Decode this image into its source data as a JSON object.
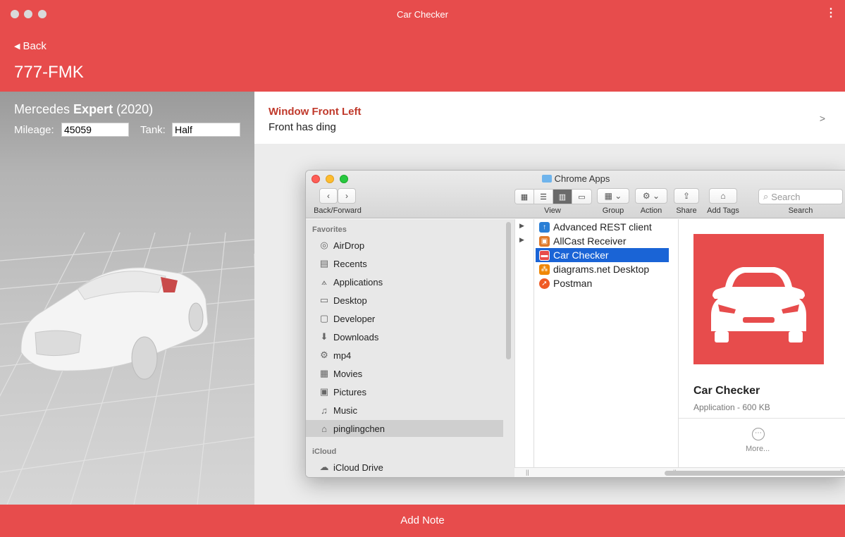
{
  "window": {
    "title": "Car Checker"
  },
  "header": {
    "back_label": "Back",
    "plate": "777-FMK"
  },
  "vehicle": {
    "make": "Mercedes",
    "model": "Expert",
    "year": "(2020)",
    "mileage_label": "Mileage:",
    "mileage_value": "45059",
    "tank_label": "Tank:",
    "tank_value": "Half"
  },
  "note": {
    "title": "Window Front Left",
    "text": "Front has ding",
    "chevron": ">"
  },
  "footer": {
    "add_note_label": "Add Note"
  },
  "finder": {
    "title": "Chrome Apps",
    "toolbar": {
      "back_forward_label": "Back/Forward",
      "view_label": "View",
      "group_label": "Group",
      "action_label": "Action",
      "share_label": "Share",
      "add_tags_label": "Add Tags",
      "search_label": "Search",
      "search_placeholder": "Search"
    },
    "sidebar": {
      "favorites_heading": "Favorites",
      "favorites": [
        {
          "label": "AirDrop",
          "icon": "airdrop-icon"
        },
        {
          "label": "Recents",
          "icon": "recents-icon"
        },
        {
          "label": "Applications",
          "icon": "applications-icon"
        },
        {
          "label": "Desktop",
          "icon": "desktop-icon"
        },
        {
          "label": "Developer",
          "icon": "folder-icon"
        },
        {
          "label": "Downloads",
          "icon": "downloads-icon"
        },
        {
          "label": "mp4",
          "icon": "gear-icon"
        },
        {
          "label": "Movies",
          "icon": "movies-icon"
        },
        {
          "label": "Pictures",
          "icon": "pictures-icon"
        },
        {
          "label": "Music",
          "icon": "music-icon"
        },
        {
          "label": "pinglingchen",
          "icon": "home-icon"
        }
      ],
      "icloud_heading": "iCloud",
      "icloud": [
        {
          "label": "iCloud Drive",
          "icon": "cloud-icon"
        }
      ]
    },
    "files": [
      {
        "name": "Advanced REST client",
        "color": "#2a7fd6"
      },
      {
        "name": "AllCast Receiver",
        "color": "#e07a2a"
      },
      {
        "name": "Car Checker",
        "color": "#e74c4c"
      },
      {
        "name": "diagrams.net Desktop",
        "color": "#f08705"
      },
      {
        "name": "Postman",
        "color": "#ef5b25"
      }
    ],
    "preview": {
      "name": "Car Checker",
      "meta": "Application - 600 KB",
      "more_label": "More..."
    }
  },
  "colors": {
    "accent": "#e74c4c",
    "selection": "#1a64d6"
  }
}
